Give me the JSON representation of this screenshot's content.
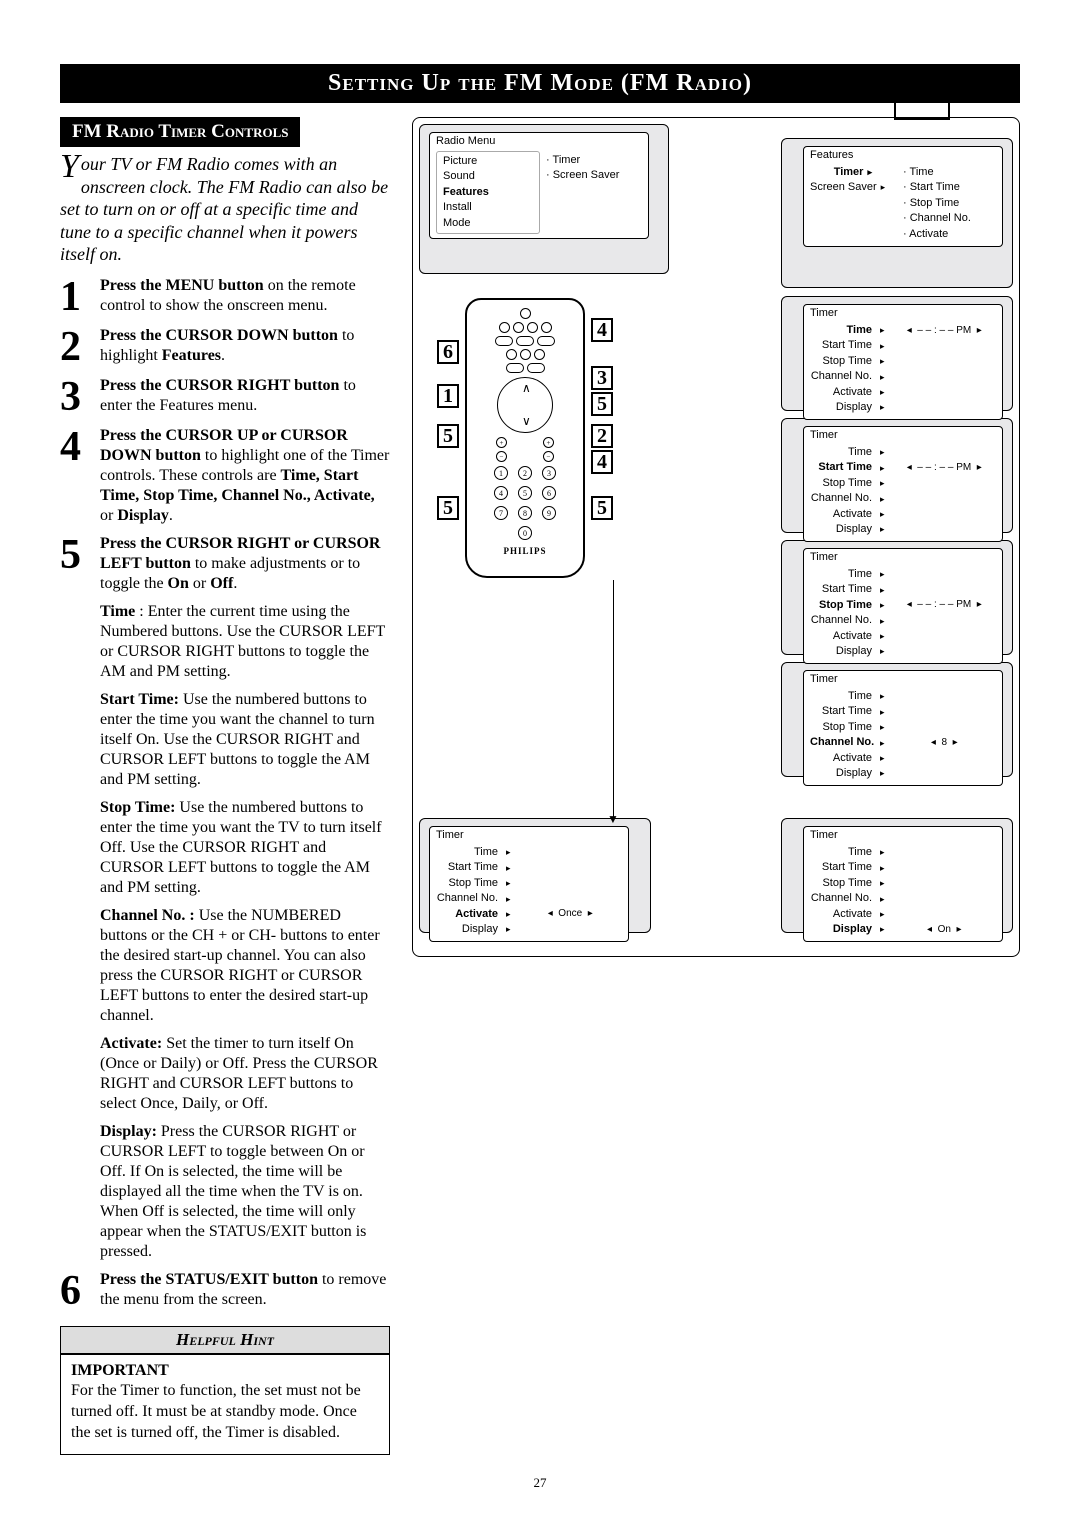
{
  "header": {
    "title": "Setting Up the FM Mode (FM Radio)",
    "icon": "music-note-icon"
  },
  "subheader": "FM Radio Timer Controls",
  "intro": "Your TV or FM Radio comes with an onscreen clock. The FM Radio can also be set to turn on or off at a specific time and tune to a specific channel when it powers itself on.",
  "steps": [
    {
      "num": "1",
      "text": "<b>Press the MENU button</b> on the remote control to show the onscreen menu."
    },
    {
      "num": "2",
      "text": "<b>Press the CURSOR DOWN button</b> to highlight <b>Features</b>."
    },
    {
      "num": "3",
      "text": "<b>Press the CURSOR RIGHT button</b> to enter the Features menu."
    },
    {
      "num": "4",
      "text": "<b>Press the CURSOR UP or CURSOR DOWN button</b> to highlight one of the Timer controls. These controls are <b>Time, Start Time, Stop Time, Channel No., Activate,</b> or <b>Display</b>."
    },
    {
      "num": "5",
      "text": "<b>Press the CURSOR RIGHT or CURSOR LEFT button</b> to make adjustments or to toggle the <b>On</b> or <b>Off</b>."
    }
  ],
  "details": [
    "<b>Time</b> : Enter the current time using the Numbered buttons. Use the CURSOR LEFT or CURSOR RIGHT buttons to toggle the AM and PM setting.",
    "<b>Start Time:</b> Use the numbered buttons to enter the time you want the channel to turn itself On. Use the CURSOR RIGHT and CURSOR LEFT buttons to toggle the AM and PM setting.",
    "<b>Stop Time:</b> Use the numbered buttons to enter the time you want the TV to turn itself Off. Use the CURSOR RIGHT and CURSOR LEFT buttons to toggle the AM and PM setting.",
    "<b>Channel No. :</b> Use the NUMBERED buttons or the CH + or CH- buttons to enter the desired start-up channel. You can also press the CURSOR RIGHT or CURSOR LEFT buttons to enter the desired start-up channel.",
    "<b>Activate:</b> Set the timer to turn itself On (Once or Daily) or Off. Press the CURSOR RIGHT and CURSOR LEFT buttons to select Once, Daily, or Off.",
    "<b>Display:</b> Press the CURSOR RIGHT or CURSOR LEFT to toggle between On or Off. If On is selected, the time will be displayed all the time when the TV is on. When Off is selected, the time will only appear when the STATUS/EXIT button is pressed."
  ],
  "step6": {
    "num": "6",
    "text": "<b>Press the STATUS/EXIT button</b> to remove the menu from the screen."
  },
  "hint": {
    "title": "Helpful Hint",
    "important": "IMPORTANT",
    "body": "For the Timer to function, the set must not be turned off. It must be at standby mode. Once the set is turned off, the Timer is disabled."
  },
  "page_number": "27",
  "osd": {
    "radio_menu": {
      "title": "Radio Menu",
      "left": [
        "Picture",
        "Sound",
        "Features",
        "Install",
        "Mode"
      ],
      "highlight": "Features",
      "right": [
        "· Timer",
        "· Screen Saver"
      ]
    },
    "features": {
      "title": "Features",
      "items": [
        "Timer",
        "Screen Saver"
      ],
      "highlight": "Timer",
      "right": [
        "· Time",
        "· Start Time",
        "· Stop Time",
        "· Channel No.",
        "· Activate"
      ]
    },
    "timer_time": {
      "title": "Timer",
      "rows": [
        "Time",
        "Start Time",
        "Stop Time",
        "Channel No.",
        "Activate",
        "Display"
      ],
      "highlight": "Time",
      "value": "– – : – – PM"
    },
    "timer_start": {
      "title": "Timer",
      "rows": [
        "Time",
        "Start Time",
        "Stop Time",
        "Channel No.",
        "Activate",
        "Display"
      ],
      "highlight": "Start Time",
      "value": "– – : – – PM"
    },
    "timer_stop": {
      "title": "Timer",
      "rows": [
        "Time",
        "Start Time",
        "Stop Time",
        "Channel No.",
        "Activate",
        "Display"
      ],
      "highlight": "Stop Time",
      "value": "– – : – – PM"
    },
    "timer_channel": {
      "title": "Timer",
      "rows": [
        "Time",
        "Start Time",
        "Stop Time",
        "Channel No.",
        "Activate",
        "Display"
      ],
      "highlight": "Channel No.",
      "value": "8"
    },
    "timer_activate": {
      "title": "Timer",
      "rows": [
        "Time",
        "Start Time",
        "Stop Time",
        "Channel No.",
        "Activate",
        "Display"
      ],
      "highlight": "Activate",
      "value": "Once"
    },
    "timer_display": {
      "title": "Timer",
      "rows": [
        "Time",
        "Start Time",
        "Stop Time",
        "Channel No.",
        "Activate",
        "Display"
      ],
      "highlight": "Display",
      "value": "On"
    }
  },
  "remote": {
    "brand": "PHILIPS",
    "callouts_left": [
      "6",
      "1",
      "5",
      "5"
    ],
    "callouts_right": [
      "4",
      "3",
      "5",
      "2",
      "4",
      "5"
    ],
    "numpad": [
      "1",
      "2",
      "3",
      "4",
      "5",
      "6",
      "7",
      "8",
      "9",
      "",
      "0",
      ""
    ]
  }
}
